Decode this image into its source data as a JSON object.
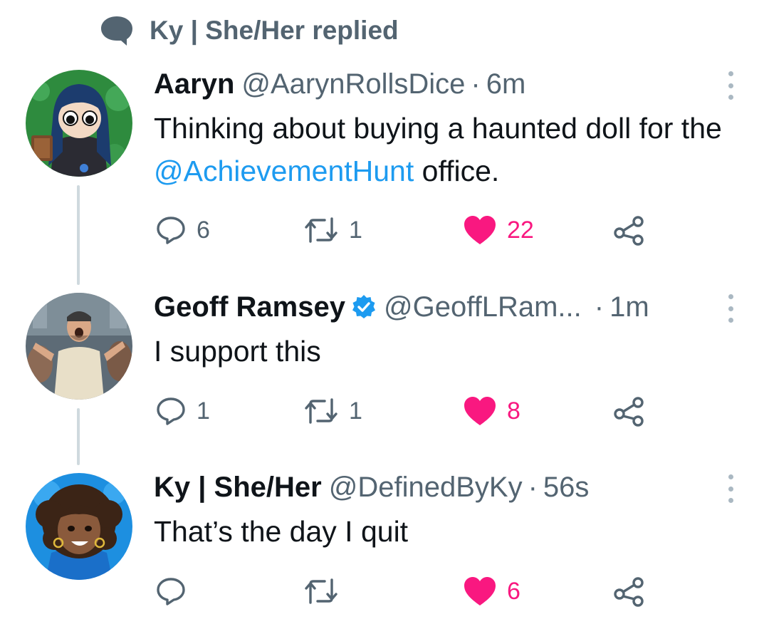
{
  "social_context": {
    "text": "Ky | She/Her replied",
    "icon": "speech-bubble-icon"
  },
  "tweets": [
    {
      "name": "Aaryn",
      "handle": "@AarynRollsDice",
      "separator": "·",
      "time": "6m",
      "verified": false,
      "text_before": "Thinking about buying a haunted doll for the ",
      "mention": "@AchievementHunt",
      "text_after": " office.",
      "replies": "6",
      "retweets": "1",
      "likes": "22",
      "liked": true
    },
    {
      "name": "Geoff Ramsey",
      "handle": "@GeoffLRam...",
      "separator": "·",
      "time": "1m",
      "verified": true,
      "text": "I support this",
      "replies": "1",
      "retweets": "1",
      "likes": "8",
      "liked": true
    },
    {
      "name": "Ky | She/Her",
      "handle": "@DefinedByKy",
      "separator": "·",
      "time": "56s",
      "verified": false,
      "text": "That’s the day I quit",
      "replies": "",
      "retweets": "",
      "likes": "6",
      "liked": true
    }
  ],
  "colors": {
    "like": "#f91880",
    "link": "#1d9bf0",
    "secondary_text": "#536471",
    "verified": "#1d9bf0",
    "thread_line": "#cfd9de"
  }
}
